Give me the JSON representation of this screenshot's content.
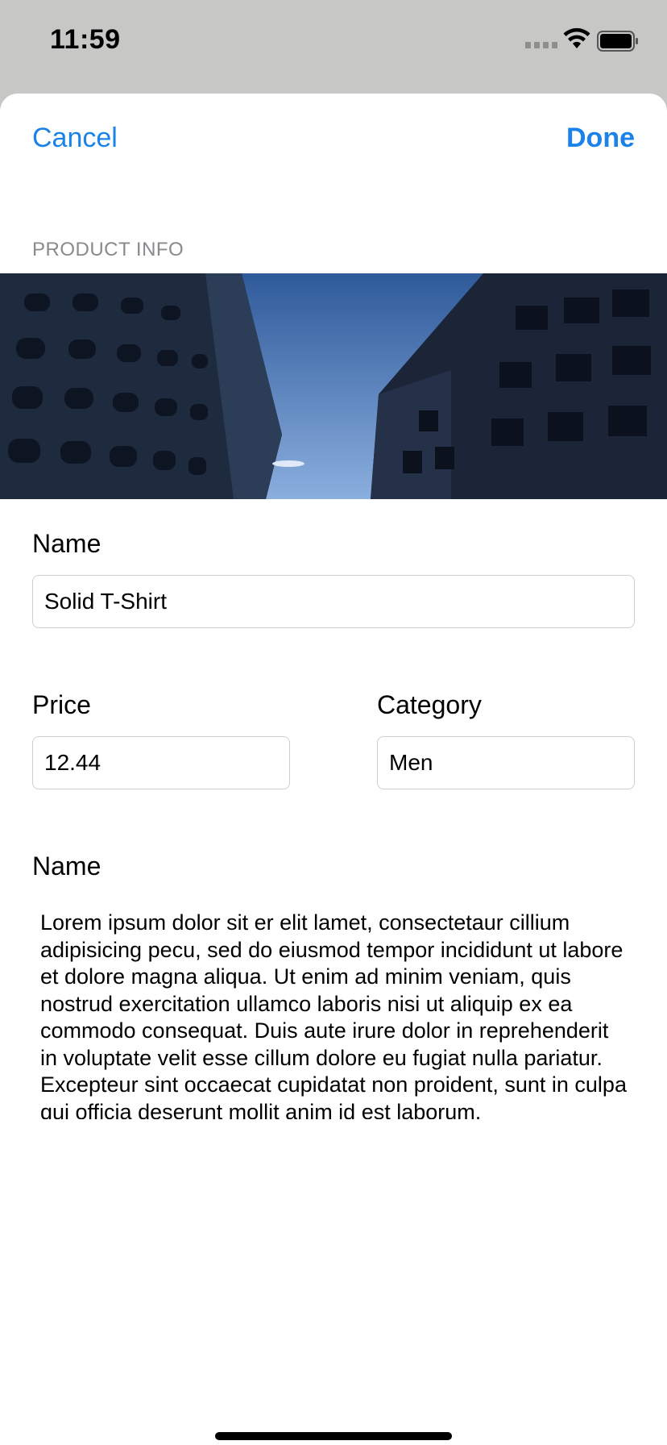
{
  "status_bar": {
    "time": "11:59"
  },
  "nav": {
    "cancel_label": "Cancel",
    "done_label": "Done"
  },
  "section": {
    "header": "PRODUCT INFO"
  },
  "form": {
    "name_label": "Name",
    "name_value": "Solid T-Shirt",
    "price_label": "Price",
    "price_value": "12.44",
    "category_label": "Category",
    "category_value": "Men",
    "description_label": "Name",
    "description_value": "Lorem ipsum dolor sit er elit lamet, consectetaur cillium adipisicing pecu, sed do eiusmod tempor incididunt ut labore et dolore magna aliqua. Ut enim ad minim veniam, quis nostrud exercitation ullamco laboris nisi ut aliquip ex ea commodo consequat. Duis aute irure dolor in reprehenderit in voluptate velit esse cillum dolore eu fugiat nulla pariatur. Excepteur sint occaecat cupidatat non proident, sunt in culpa qui officia deserunt mollit anim id est laborum."
  }
}
